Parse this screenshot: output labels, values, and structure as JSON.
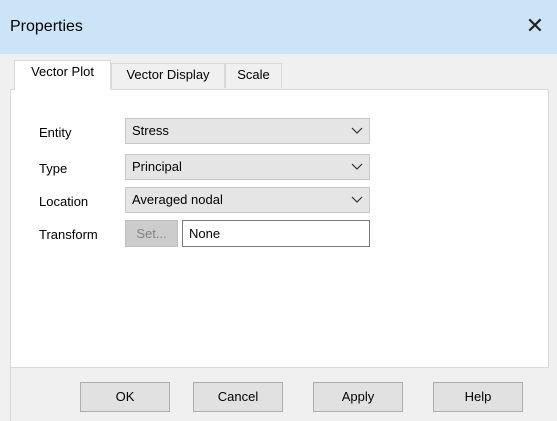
{
  "window": {
    "title": "Properties",
    "close_glyph": "✕"
  },
  "tabs": [
    {
      "label": "Vector Plot",
      "active": true
    },
    {
      "label": "Vector Display",
      "active": false
    },
    {
      "label": "Scale",
      "active": false
    }
  ],
  "form": {
    "entity": {
      "label": "Entity",
      "value": "Stress"
    },
    "type": {
      "label": "Type",
      "value": "Principal"
    },
    "location": {
      "label": "Location",
      "value": "Averaged nodal"
    },
    "transform": {
      "label": "Transform",
      "button_label": "Set...",
      "value": "None"
    }
  },
  "buttons": {
    "ok": "OK",
    "cancel": "Cancel",
    "apply": "Apply",
    "help": "Help"
  },
  "icons": {
    "close": "close-icon",
    "dropdown": "chevron-down-icon"
  },
  "colors": {
    "titlebar": "#cce4f7",
    "dialog_background": "#f0f0f0",
    "panel_background": "#ffffff",
    "select_background": "#e5e5e5",
    "disabled_button_background": "#cccccc",
    "button_background": "#e1e1e1"
  }
}
